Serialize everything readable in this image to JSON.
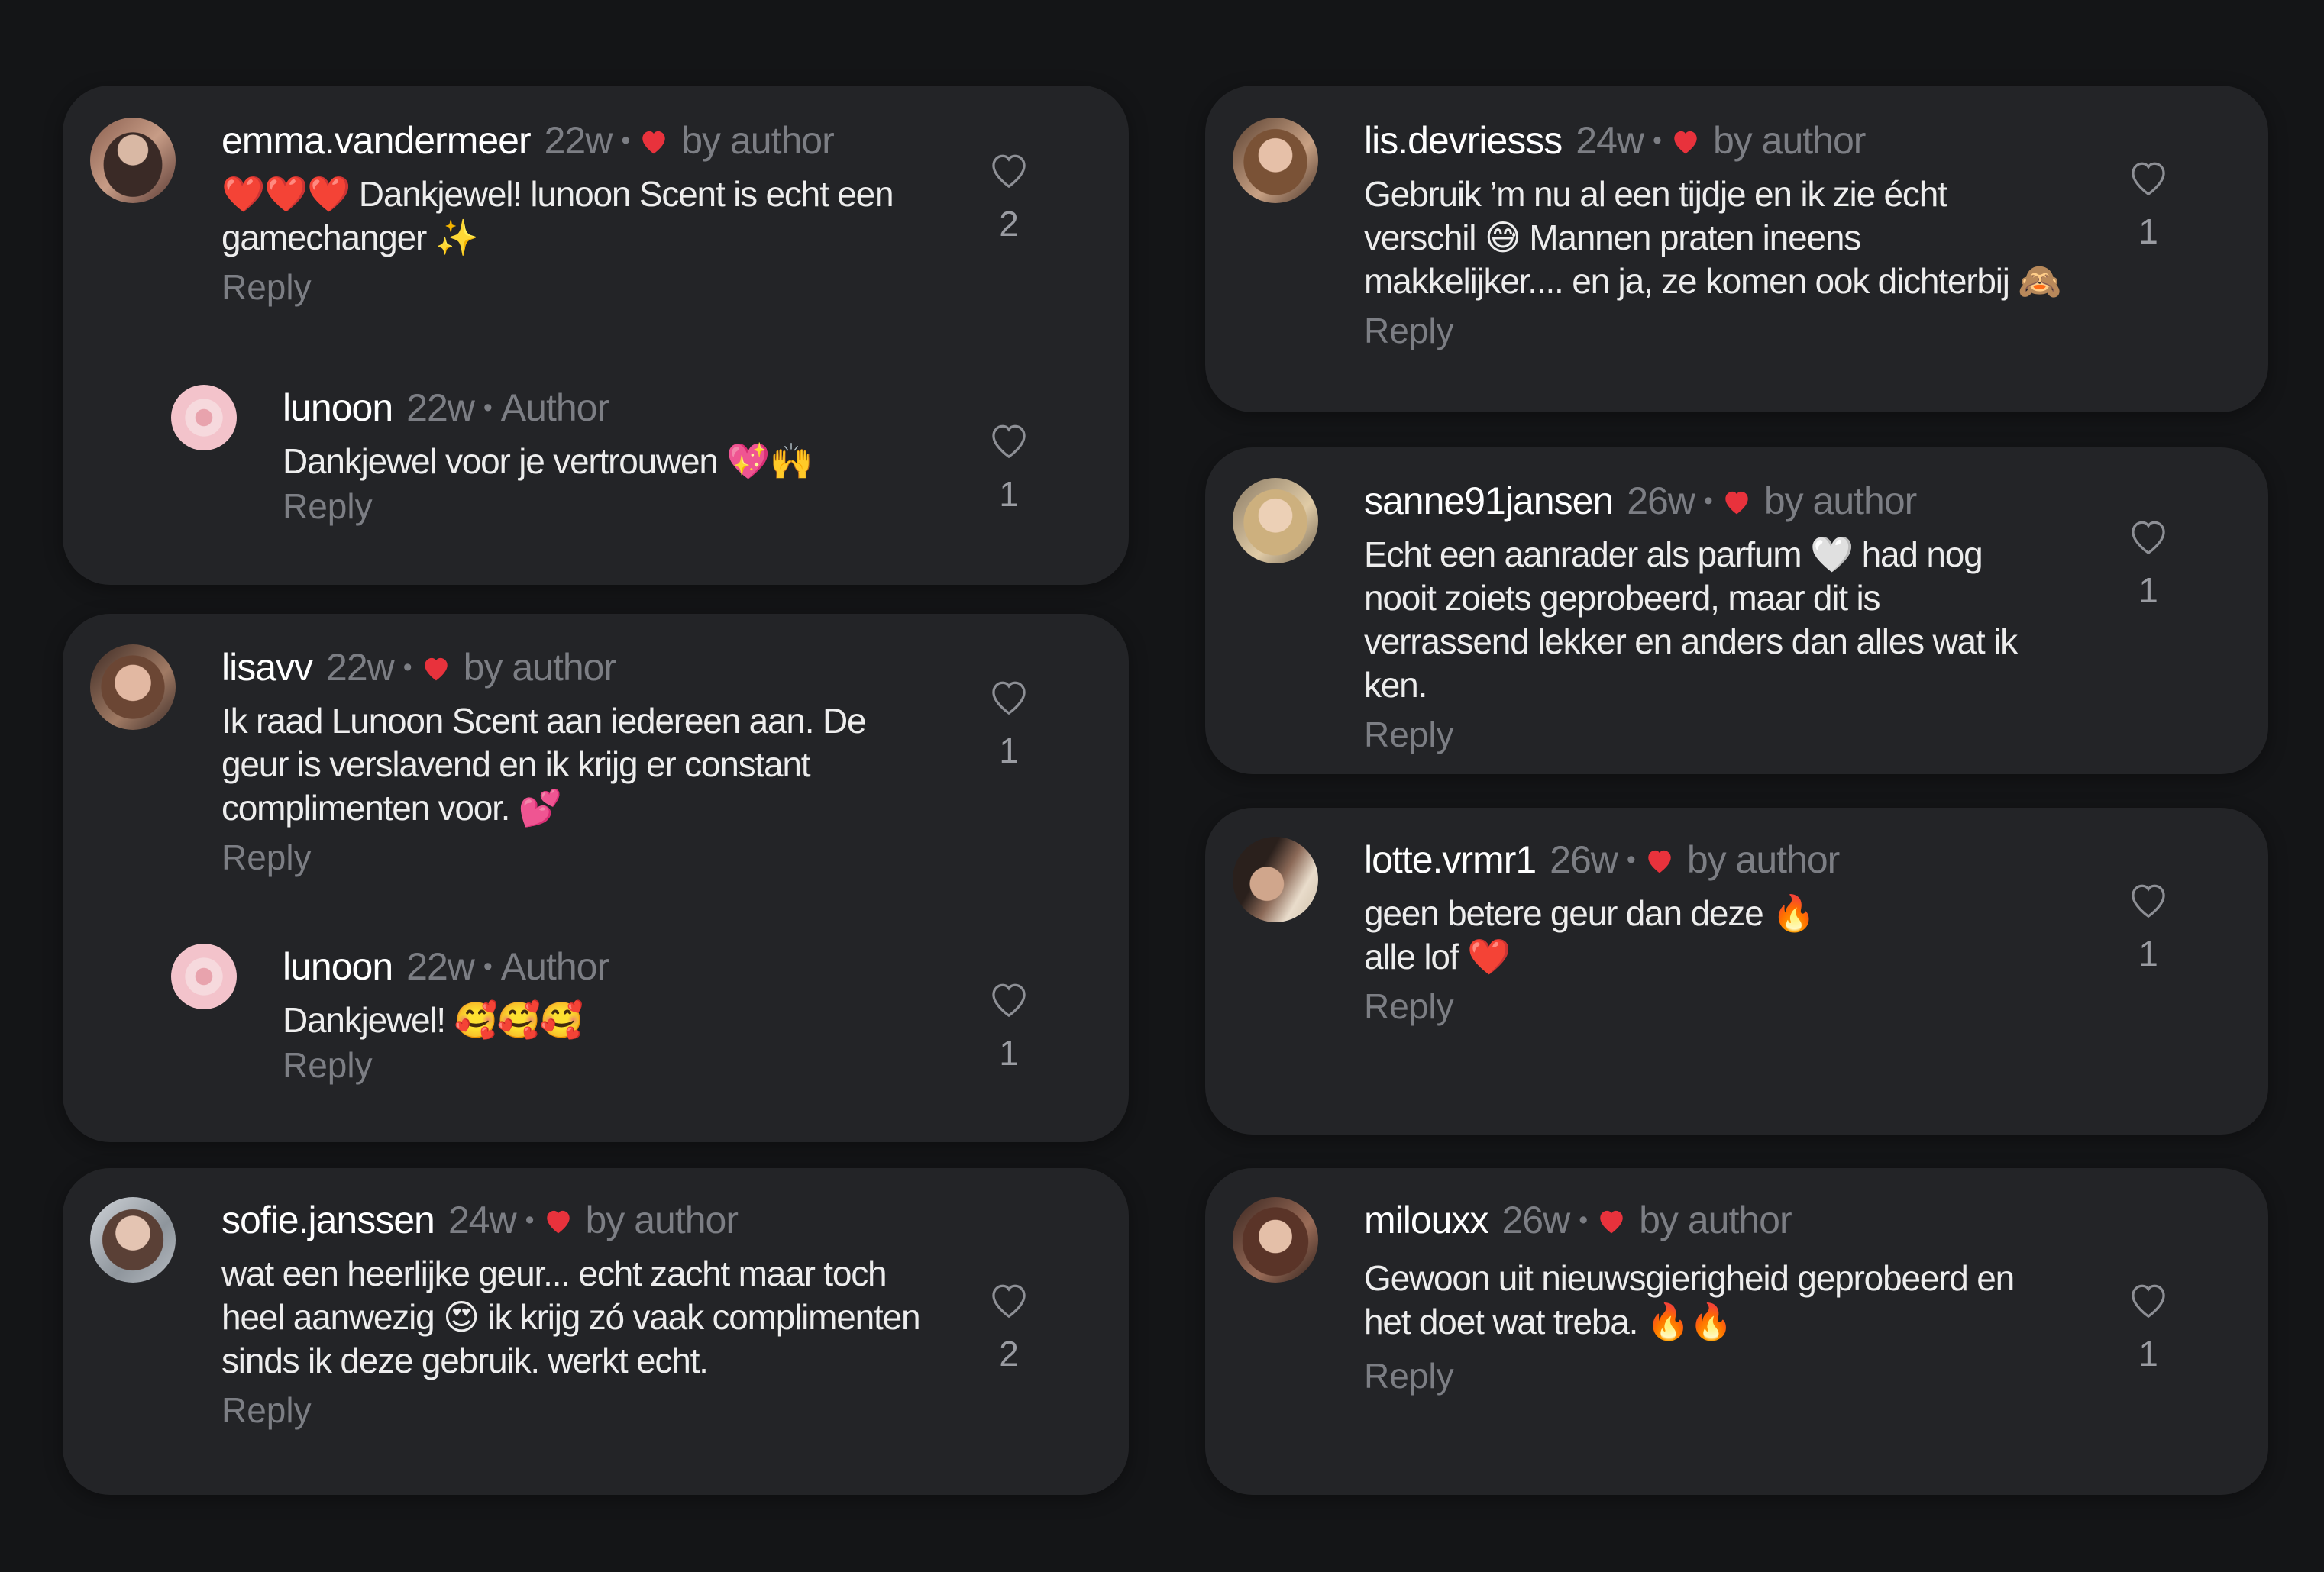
{
  "colors": {
    "background": "#141517",
    "card": "#232427",
    "muted": "#7c7e84",
    "heart": "#e8323c"
  },
  "cards": [
    {
      "comments": [
        {
          "username": "emma.vandermeer",
          "time": "22w",
          "badge": "by author",
          "badge_type": "liked",
          "text": "❤️❤️❤️ Dankjewel! lunoon Scent is echt een gamechanger ✨",
          "reply": "Reply",
          "likes": "2",
          "avatar_icon": "avatar-photo"
        },
        {
          "username": "lunoon",
          "time": "22w",
          "badge": "Author",
          "badge_type": "author",
          "text": "Dankjewel voor je vertrouwen 💖🙌",
          "reply": "Reply",
          "likes": "1",
          "avatar_icon": "brand-logo"
        }
      ]
    },
    {
      "comments": [
        {
          "username": "lisavv",
          "time": "22w",
          "badge": "by author",
          "badge_type": "liked",
          "text": "Ik raad Lunoon Scent aan iedereen aan. De geur is verslavend en ik krijg er constant complimenten voor. 💕",
          "reply": "Reply",
          "likes": "1",
          "avatar_icon": "avatar-photo"
        },
        {
          "username": "lunoon",
          "time": "22w",
          "badge": "Author",
          "badge_type": "author",
          "text": "Dankjewel! 🥰🥰🥰",
          "reply": "Reply",
          "likes": "1",
          "avatar_icon": "brand-logo"
        }
      ]
    },
    {
      "comments": [
        {
          "username": "sofie.janssen",
          "time": "24w",
          "badge": "by author",
          "badge_type": "liked",
          "text": "wat een heerlijke geur... echt zacht maar toch heel aanwezig 😍 ik krijg zó vaak complimenten sinds ik deze gebruik. werkt echt.",
          "reply": "Reply",
          "likes": "2",
          "avatar_icon": "avatar-photo"
        }
      ]
    },
    {
      "comments": [
        {
          "username": "lis.devriesss",
          "time": "24w",
          "badge": "by author",
          "badge_type": "liked",
          "text": "Gebruik ’m nu al een tijdje en ik zie écht verschil 😅 Mannen praten ineens makkelijker.... en ja, ze komen ook dichterbij 🙈",
          "reply": "Reply",
          "likes": "1",
          "avatar_icon": "avatar-photo"
        }
      ]
    },
    {
      "comments": [
        {
          "username": "sanne91jansen",
          "time": "26w",
          "badge": "by author",
          "badge_type": "liked",
          "text": "Echt een aanrader als parfum 🤍 had nog nooit zoiets geprobeerd, maar dit is verrassend lekker en anders dan alles wat ik ken.",
          "reply": "Reply",
          "likes": "1",
          "avatar_icon": "avatar-photo"
        }
      ]
    },
    {
      "comments": [
        {
          "username": "lotte.vrmr1",
          "time": "26w",
          "badge": "by author",
          "badge_type": "liked",
          "text": "geen betere geur dan deze 🔥\nalle lof ❤️",
          "reply": "Reply",
          "likes": "1",
          "avatar_icon": "avatar-photo"
        }
      ]
    },
    {
      "comments": [
        {
          "username": "milouxx",
          "time": "26w",
          "badge": "by author",
          "badge_type": "liked",
          "text": "Gewoon uit nieuwsgierigheid geprobeerd en het doet wat treba. 🔥🔥",
          "reply": "Reply",
          "likes": "1",
          "avatar_icon": "avatar-photo"
        }
      ]
    }
  ]
}
